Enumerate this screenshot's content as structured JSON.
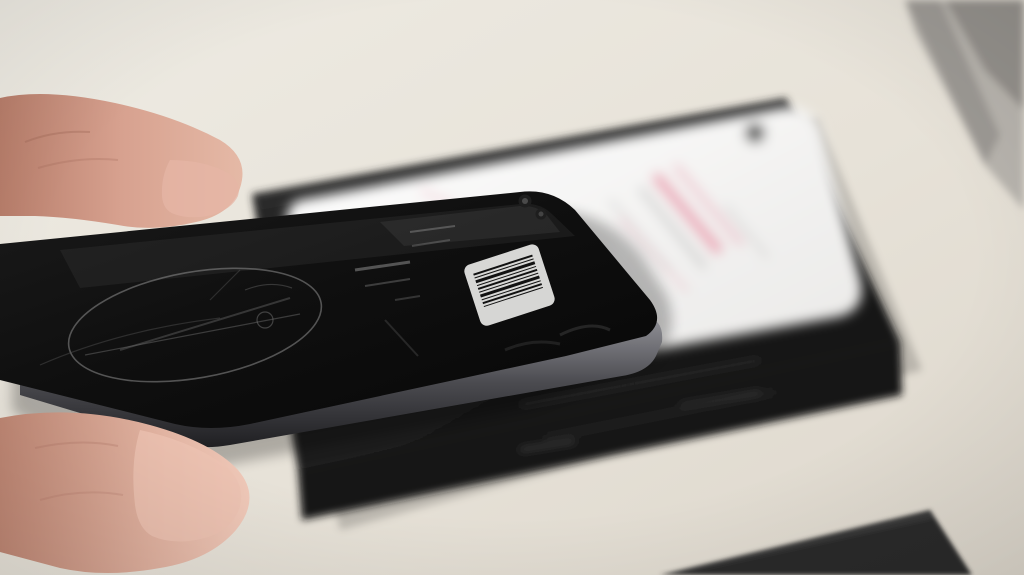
{
  "scene": {
    "colors": {
      "table": "#e9e5dc",
      "box": "#1c1c1c",
      "phone_body": "#101010",
      "phone_edge": "#6f6f73",
      "skin": "#d8a48e",
      "white_phone": "#f4f3f1",
      "accent_pink": "#e98aa1",
      "sticker": "#e8e8e6"
    },
    "objects": [
      "hand",
      "black-smartphone",
      "phone-box",
      "white-smartphone-on-box",
      "box-corner-bottom-right",
      "object-top-right"
    ]
  },
  "overlay": {
    "barcode_label": ""
  }
}
